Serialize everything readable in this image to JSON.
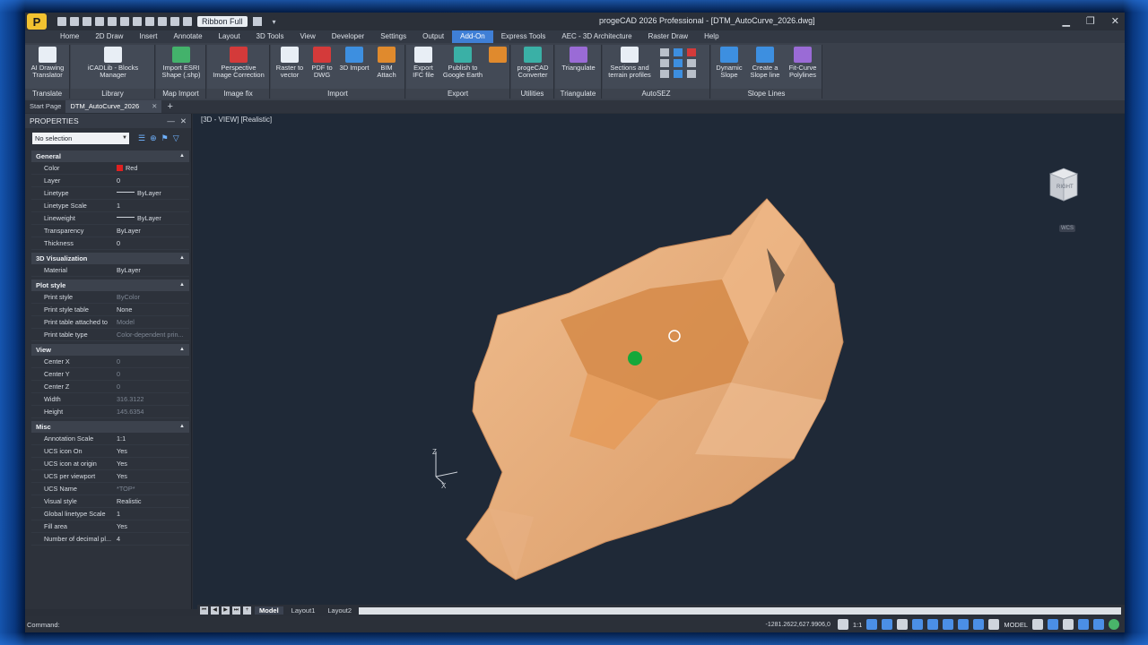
{
  "app": {
    "title": "progeCAD 2026 Professional - [DTM_AutoCurve_2026.dwg]",
    "logo_icon": "progecad-logo-icon",
    "ribbon_toggle": "Ribbon Full"
  },
  "tabs": [
    "Home",
    "2D Draw",
    "Insert",
    "Annotate",
    "Layout",
    "3D Tools",
    "View",
    "Developer",
    "Settings",
    "Output",
    "Add-On",
    "Express Tools",
    "AEC - 3D Architecture",
    "Raster Draw",
    "Help"
  ],
  "active_tab": "Add-On",
  "ribbon": {
    "groups": [
      {
        "label": "Translate",
        "buttons": [
          {
            "label": "AI Drawing Translator",
            "icon": "translate-icon"
          }
        ]
      },
      {
        "label": "Library",
        "buttons": [
          {
            "label": "iCADLib - Blocks Manager",
            "icon": "library-icon"
          }
        ]
      },
      {
        "label": "Map Import",
        "buttons": [
          {
            "label": "Import ESRI Shape (.shp)",
            "icon": "esri-icon"
          }
        ]
      },
      {
        "label": "Image fix",
        "buttons": [
          {
            "label": "Perspective Image Correction",
            "icon": "perspective-icon"
          }
        ]
      },
      {
        "label": "Import",
        "buttons": [
          {
            "label": "Raster to vector",
            "icon": "raster-icon"
          },
          {
            "label": "PDF to DWG",
            "icon": "pdf-icon"
          },
          {
            "label": "3D Import",
            "icon": "step-icon"
          },
          {
            "label": "BIM Attach",
            "icon": "bim-icon"
          }
        ]
      },
      {
        "label": "Export",
        "buttons": [
          {
            "label": "Export IFC file",
            "icon": "ifc-icon"
          },
          {
            "label": "Publish to Google Earth",
            "icon": "earth-icon"
          },
          {
            "label": "",
            "icon": "pdf3d-icon"
          }
        ]
      },
      {
        "label": "Utilities",
        "buttons": [
          {
            "label": "progeCAD Converter",
            "icon": "converter-icon"
          }
        ]
      },
      {
        "label": "Triangulate",
        "buttons": [
          {
            "label": "Triangulate",
            "icon": "triangulate-icon"
          }
        ]
      },
      {
        "label": "AutoSEZ",
        "buttons": [
          {
            "label": "Sections and terrain profiles",
            "icon": "sections-icon"
          }
        ]
      },
      {
        "label": "Slope Lines",
        "buttons": [
          {
            "label": "Dynamic Slope",
            "icon": "slope-icon"
          },
          {
            "label": "Create a Slope line",
            "icon": "slope-line-icon"
          },
          {
            "label": "Fit-Curve Polylines",
            "icon": "fit-curve-icon"
          }
        ]
      }
    ]
  },
  "doc_tabs": [
    "Start Page",
    "DTM_AutoCurve_2026"
  ],
  "properties": {
    "title": "PROPERTIES",
    "selection": "No selection",
    "sections": [
      {
        "title": "General",
        "rows": [
          {
            "name": "Color",
            "value": "Red",
            "swatch": "#e02020"
          },
          {
            "name": "Layer",
            "value": "0"
          },
          {
            "name": "Linetype",
            "value": "ByLayer",
            "line": true
          },
          {
            "name": "Linetype Scale",
            "value": "1"
          },
          {
            "name": "Lineweight",
            "value": "ByLayer",
            "line": true
          },
          {
            "name": "Transparency",
            "value": "ByLayer"
          },
          {
            "name": "Thickness",
            "value": "0"
          }
        ]
      },
      {
        "title": "3D Visualization",
        "rows": [
          {
            "name": "Material",
            "value": "ByLayer"
          }
        ]
      },
      {
        "title": "Plot style",
        "rows": [
          {
            "name": "Print style",
            "value": "ByColor",
            "dim": true
          },
          {
            "name": "Print style table",
            "value": "None"
          },
          {
            "name": "Print table attached to",
            "value": "Model",
            "dim": true
          },
          {
            "name": "Print table type",
            "value": "Color-dependent prin...",
            "dim": true
          }
        ]
      },
      {
        "title": "View",
        "rows": [
          {
            "name": "Center X",
            "value": "0",
            "dim": true
          },
          {
            "name": "Center Y",
            "value": "0",
            "dim": true
          },
          {
            "name": "Center Z",
            "value": "0",
            "dim": true
          },
          {
            "name": "Width",
            "value": "316.3122",
            "dim": true
          },
          {
            "name": "Height",
            "value": "145.6354",
            "dim": true
          }
        ]
      },
      {
        "title": "Misc",
        "rows": [
          {
            "name": "Annotation Scale",
            "value": "1:1"
          },
          {
            "name": "UCS icon On",
            "value": "Yes"
          },
          {
            "name": "UCS icon at origin",
            "value": "Yes"
          },
          {
            "name": "UCS per viewport",
            "value": "Yes"
          },
          {
            "name": "UCS Name",
            "value": "*TOP*",
            "dim": true
          },
          {
            "name": "Visual style",
            "value": "Realistic"
          },
          {
            "name": "Global linetype Scale",
            "value": "1"
          },
          {
            "name": "Fill area",
            "value": "Yes"
          },
          {
            "name": "Number of decimal pl...",
            "value": "4"
          }
        ]
      }
    ]
  },
  "viewport": {
    "label": "[3D - VIEW] [Realistic]",
    "viewcube_face": "RIGHT",
    "wcs": "WCS",
    "terrain_color": "#e3a876"
  },
  "layout_tabs": [
    "Model",
    "Layout1",
    "Layout2"
  ],
  "status": {
    "command_label": "Command:",
    "coords": "-1281.2622,627.9906,0",
    "scale": "1:1",
    "model": "MODEL"
  }
}
